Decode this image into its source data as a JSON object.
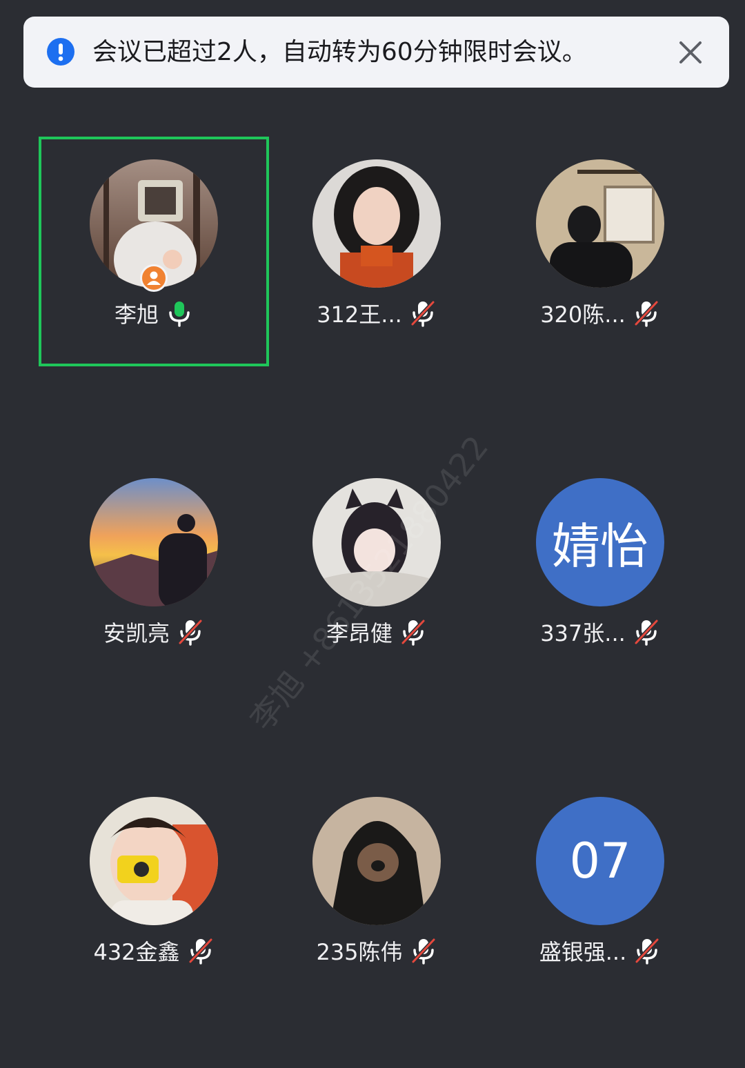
{
  "banner": {
    "message": "会议已超过2人，自动转为60分钟限时会议。",
    "icon": "info-icon",
    "accent": "#1d6ff0"
  },
  "watermark": "李旭 +8613521880422",
  "participants": [
    {
      "name": "李旭",
      "mic": "on",
      "host": true,
      "avatar": "photo-monitor-head"
    },
    {
      "name": "312王...",
      "mic": "muted",
      "avatar": "photo-curly-hair-girl"
    },
    {
      "name": "320陈...",
      "mic": "muted",
      "avatar": "photo-masked-person"
    },
    {
      "name": "安凯亮",
      "mic": "muted",
      "avatar": "photo-sunset-mountain"
    },
    {
      "name": "李昂健",
      "mic": "muted",
      "avatar": "photo-anime-cat-girl"
    },
    {
      "name": "337张...",
      "mic": "muted",
      "avatar_text": "婧怡"
    },
    {
      "name": "432金鑫",
      "mic": "muted",
      "avatar": "photo-child-camera"
    },
    {
      "name": "235陈伟",
      "mic": "muted",
      "avatar": "photo-hooded-dog"
    },
    {
      "name": "盛银强...",
      "mic": "muted",
      "avatar_text": "07"
    }
  ],
  "colors": {
    "background": "#2b2d33",
    "active_border": "#1fc65a",
    "mic_on": "#1fc65a",
    "mute_slash": "#e5483d",
    "initials_bg": "#3f6fc6",
    "host_badge": "#f08232"
  }
}
